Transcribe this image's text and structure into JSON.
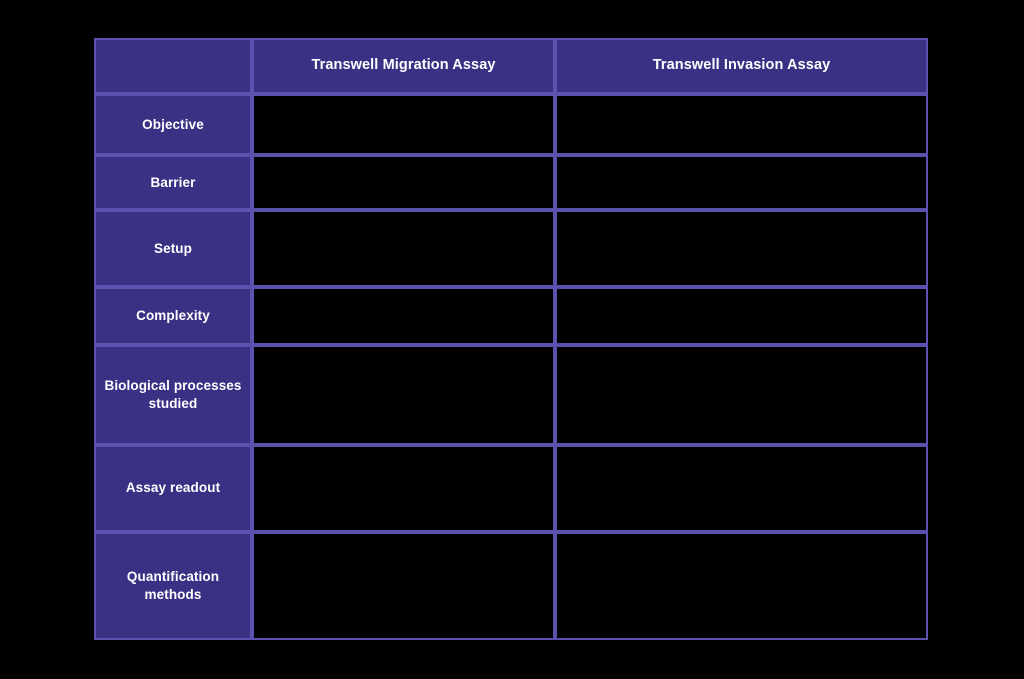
{
  "page": {
    "background_color": "#000000",
    "table_fill_color": "#3a3185",
    "table_border_color": "#5b52b0",
    "data_cell_color": "#000000",
    "text_color": "#ffffff"
  },
  "table": {
    "corner_label": "",
    "column_headers": [
      "Transwell Migration Assay",
      "Transwell Invasion Assay"
    ],
    "rows": [
      {
        "label": "Objective",
        "cells": [
          "",
          ""
        ]
      },
      {
        "label": "Barrier",
        "cells": [
          "",
          ""
        ]
      },
      {
        "label": "Setup",
        "cells": [
          "",
          ""
        ]
      },
      {
        "label": "Complexity",
        "cells": [
          "",
          ""
        ]
      },
      {
        "label": "Biological processes studied",
        "cells": [
          "",
          ""
        ]
      },
      {
        "label": "Assay readout",
        "cells": [
          "",
          ""
        ]
      },
      {
        "label": "Quantification methods",
        "cells": [
          "",
          ""
        ]
      }
    ]
  }
}
